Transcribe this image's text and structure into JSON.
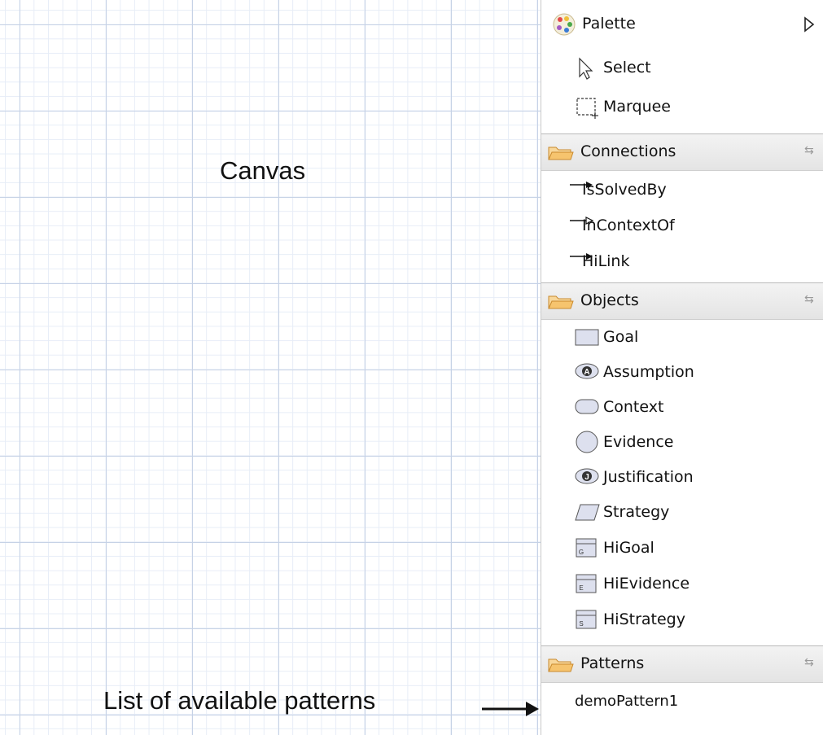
{
  "canvas": {
    "label": "Canvas"
  },
  "annotation": {
    "patterns_note": "List of available patterns"
  },
  "palette": {
    "title": "Palette",
    "tools": [
      {
        "label": "Select",
        "icon": "cursor-arrow-icon"
      },
      {
        "label": "Marquee",
        "icon": "marquee-icon"
      }
    ],
    "drawers": {
      "connections": {
        "label": "Connections",
        "items": [
          {
            "label": "IsSolvedBy",
            "icon": "solid-arrow-icon"
          },
          {
            "label": "InContextOf",
            "icon": "hollow-arrow-icon"
          },
          {
            "label": "HiLink",
            "icon": "solid-arrow-icon"
          }
        ]
      },
      "objects": {
        "label": "Objects",
        "items": [
          {
            "label": "Goal",
            "icon": "goal-rectangle-icon"
          },
          {
            "label": "Assumption",
            "icon": "assumption-ellipse-icon",
            "icon_letter": "A"
          },
          {
            "label": "Context",
            "icon": "context-rounded-rect-icon"
          },
          {
            "label": "Evidence",
            "icon": "evidence-circle-icon"
          },
          {
            "label": "Justification",
            "icon": "justification-ellipse-icon",
            "icon_letter": "J"
          },
          {
            "label": "Strategy",
            "icon": "strategy-parallelogram-icon"
          },
          {
            "label": "HiGoal",
            "icon": "higoal-icon",
            "icon_letter": "G"
          },
          {
            "label": "HiEvidence",
            "icon": "hievidence-icon",
            "icon_letter": "E"
          },
          {
            "label": "HiStrategy",
            "icon": "histrategy-icon",
            "icon_letter": "S"
          }
        ]
      },
      "patterns": {
        "label": "Patterns",
        "items": [
          {
            "label": "demoPattern1"
          }
        ]
      }
    }
  },
  "colors": {
    "grid_major": "#c6d2e6",
    "grid_minor": "#e7edf7",
    "folder": "#f0a640",
    "shape_fill": "#dde0ee"
  }
}
